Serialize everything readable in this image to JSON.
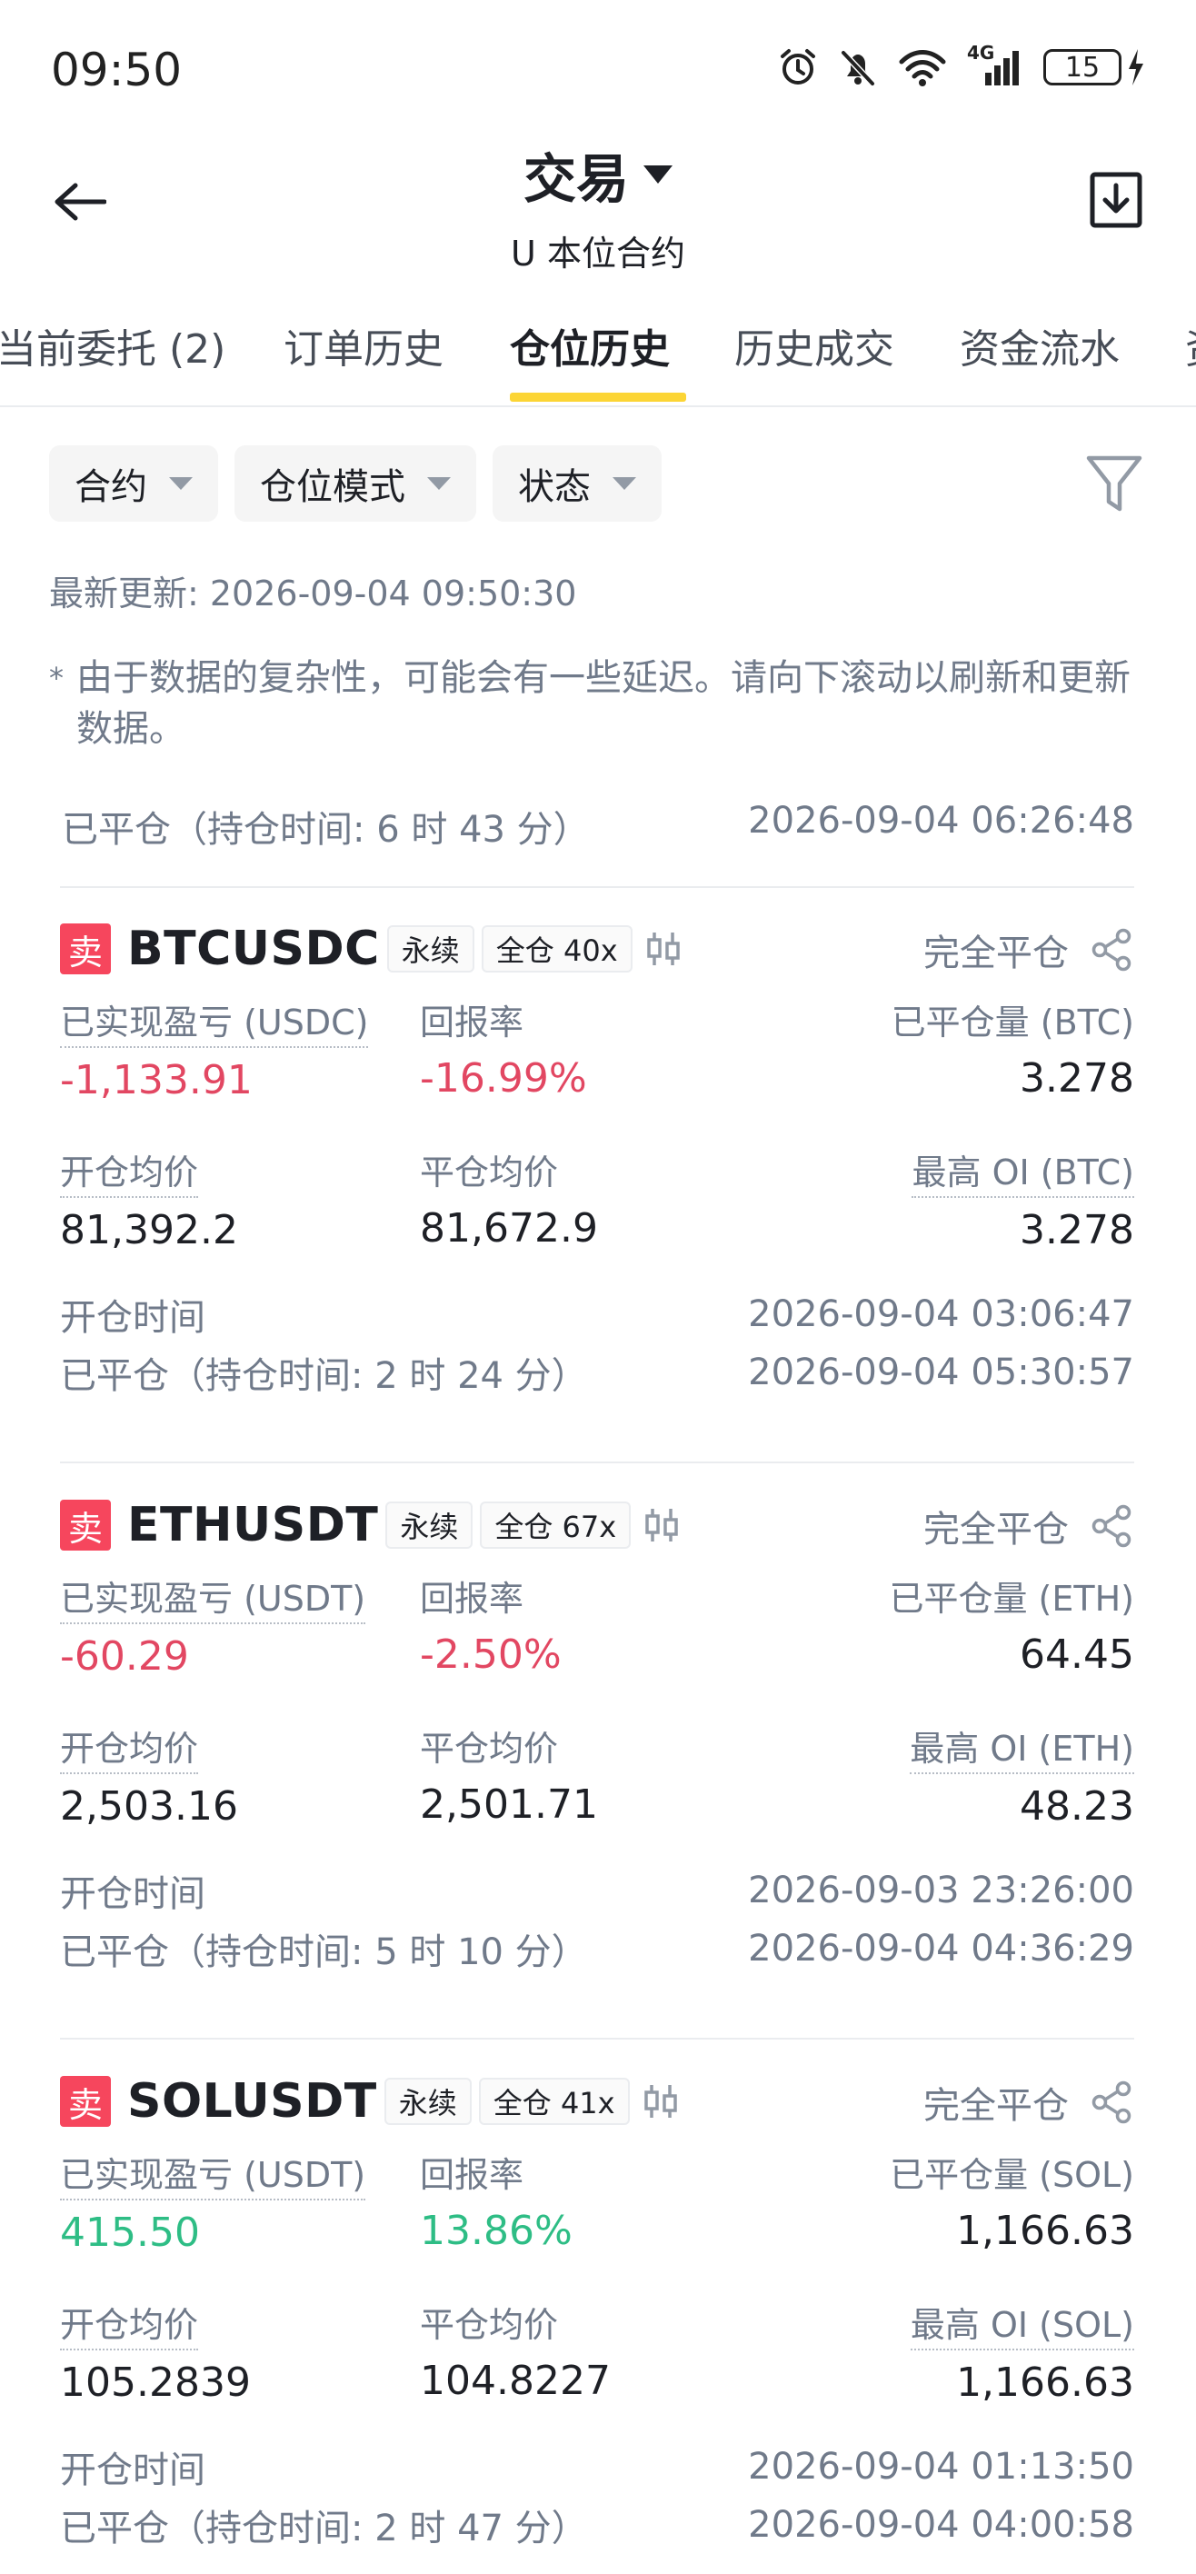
{
  "status_bar": {
    "time": "09:50",
    "network": "4G",
    "battery": "15"
  },
  "header": {
    "title": "交易",
    "subtitle": "U 本位合约"
  },
  "tabs": [
    {
      "label": "当前委托 (2)"
    },
    {
      "label": "订单历史"
    },
    {
      "label": "仓位历史"
    },
    {
      "label": "历史成交"
    },
    {
      "label": "资金流水"
    },
    {
      "label": "资"
    }
  ],
  "active_tab": "仓位历史",
  "filters": [
    {
      "label": "合约"
    },
    {
      "label": "仓位模式"
    },
    {
      "label": "状态"
    }
  ],
  "updated": "最新更新: 2026-09-04 09:50:30",
  "notice": {
    "star": "*",
    "text": "由于数据的复杂性，可能会有一些延迟。请向下滚动以刷新和更新数据。"
  },
  "summary": {
    "left": "已平仓（持仓时间: 6 时 43 分）",
    "right": "2026-09-04 06:26:48"
  },
  "colors": {
    "accent": "#fcd535",
    "sell": "#f6465d",
    "negative": "#e24762",
    "positive": "#2ebd85",
    "muted": "#707a8a"
  },
  "positions": [
    {
      "side": "卖",
      "symbol": "BTCUSDC",
      "tag_type": "永续",
      "tag_margin": "全仓 40x",
      "status": "完全平仓",
      "pnl_label": "已实现盈亏 (USDC)",
      "pnl_value": "-1,133.91",
      "roi_label": "回报率",
      "roi_value": "-16.99%",
      "closed_qty_label": "已平仓量 (BTC)",
      "closed_qty_value": "3.278",
      "entry_label": "开仓均价",
      "entry_value": "81,392.2",
      "exit_label": "平仓均价",
      "exit_value": "81,672.9",
      "max_oi_label": "最高 OI (BTC)",
      "max_oi_value": "3.278",
      "open_time_label": "开仓时间",
      "open_time_value": "2026-09-04 03:06:47",
      "closed_label": "已平仓（持仓时间: 2 时 24 分）",
      "closed_value": "2026-09-04 05:30:57"
    },
    {
      "side": "卖",
      "symbol": "ETHUSDT",
      "tag_type": "永续",
      "tag_margin": "全仓 67x",
      "status": "完全平仓",
      "pnl_label": "已实现盈亏 (USDT)",
      "pnl_value": "-60.29",
      "roi_label": "回报率",
      "roi_value": "-2.50%",
      "closed_qty_label": "已平仓量 (ETH)",
      "closed_qty_value": "64.45",
      "entry_label": "开仓均价",
      "entry_value": "2,503.16",
      "exit_label": "平仓均价",
      "exit_value": "2,501.71",
      "max_oi_label": "最高 OI (ETH)",
      "max_oi_value": "48.23",
      "open_time_label": "开仓时间",
      "open_time_value": "2026-09-03 23:26:00",
      "closed_label": "已平仓（持仓时间: 5 时 10 分）",
      "closed_value": "2026-09-04 04:36:29"
    },
    {
      "side": "卖",
      "symbol": "SOLUSDT",
      "tag_type": "永续",
      "tag_margin": "全仓 41x",
      "status": "完全平仓",
      "pnl_label": "已实现盈亏 (USDT)",
      "pnl_value": "415.50",
      "roi_label": "回报率",
      "roi_value": "13.86%",
      "closed_qty_label": "已平仓量 (SOL)",
      "closed_qty_value": "1,166.63",
      "entry_label": "开仓均价",
      "entry_value": "105.2839",
      "exit_label": "平仓均价",
      "exit_value": "104.8227",
      "max_oi_label": "最高 OI (SOL)",
      "max_oi_value": "1,166.63",
      "open_time_label": "开仓时间",
      "open_time_value": "2026-09-04 01:13:50",
      "closed_label": "已平仓（持仓时间: 2 时 47 分）",
      "closed_value": "2026-09-04 04:00:58"
    }
  ]
}
